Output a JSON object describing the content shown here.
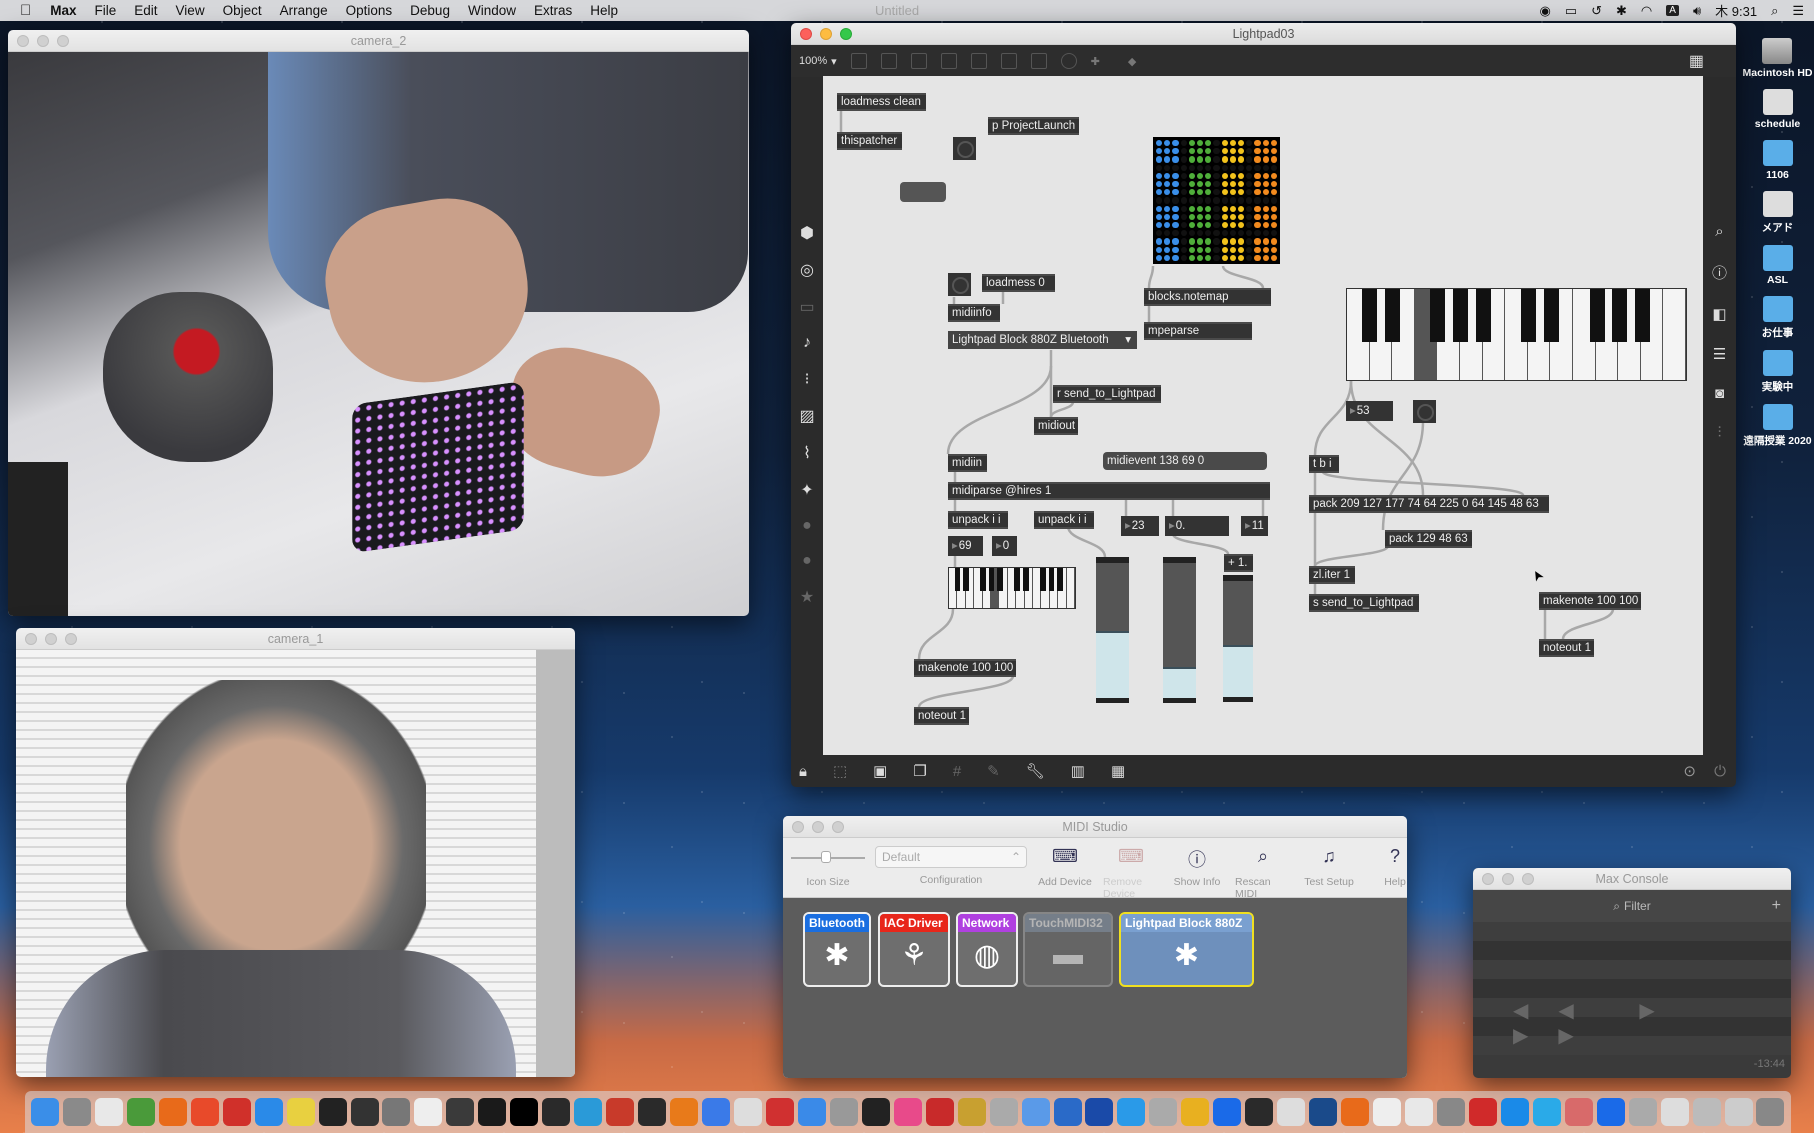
{
  "menubar": {
    "apple": "",
    "app": "Max",
    "items": [
      "File",
      "Edit",
      "View",
      "Object",
      "Arrange",
      "Options",
      "Debug",
      "Window",
      "Extras",
      "Help"
    ],
    "center_title": "Untitled",
    "clock": "木 9:31",
    "input_method": "A"
  },
  "camera2": {
    "title": "camera_2"
  },
  "camera1": {
    "title": "camera_1"
  },
  "patcher": {
    "title": "Lightpad03",
    "zoom": "100%",
    "objects": [
      {
        "id": "loadmess_clean",
        "text": "loadmess clean"
      },
      {
        "id": "thispatcher",
        "text": "thispatcher"
      },
      {
        "id": "projectlaunch",
        "text": "p ProjectLaunch"
      },
      {
        "id": "loadmess0",
        "text": "loadmess 0"
      },
      {
        "id": "midiinfo",
        "text": "midiinfo"
      },
      {
        "id": "blocks_notemap",
        "text": "blocks.notemap"
      },
      {
        "id": "mpeparse",
        "text": "mpeparse"
      },
      {
        "id": "r_send",
        "text": "r send_to_Lightpad"
      },
      {
        "id": "midiout",
        "text": "midiout"
      },
      {
        "id": "midiin",
        "text": "midiin"
      },
      {
        "id": "midiparse",
        "text": "midiparse @hires 1"
      },
      {
        "id": "unpack1",
        "text": "unpack i i"
      },
      {
        "id": "unpack2",
        "text": "unpack i i"
      },
      {
        "id": "plus1",
        "text": "+ 1."
      },
      {
        "id": "makenote_l",
        "text": "makenote 100 100"
      },
      {
        "id": "noteout_l",
        "text": "noteout 1"
      },
      {
        "id": "tbi",
        "text": "t b i"
      },
      {
        "id": "pack_big",
        "text": "pack 209 127 177 74 64 225 0 64 145 48 63"
      },
      {
        "id": "pack_small",
        "text": "pack 129 48 63"
      },
      {
        "id": "zliter",
        "text": "zl.iter 1"
      },
      {
        "id": "s_send",
        "text": "s send_to_Lightpad"
      },
      {
        "id": "makenote_r",
        "text": "makenote 100 100"
      },
      {
        "id": "noteout_r",
        "text": "noteout 1"
      }
    ],
    "messages": [
      {
        "id": "midievent",
        "text": "midievent 138 69 0"
      }
    ],
    "menu": {
      "selected": "Lightpad Block 880Z Bluetooth"
    },
    "numbers": [
      {
        "id": "n23",
        "value": "23"
      },
      {
        "id": "n0f",
        "value": "0."
      },
      {
        "id": "n11",
        "value": "11"
      },
      {
        "id": "n69",
        "value": "69"
      },
      {
        "id": "n0",
        "value": "0"
      },
      {
        "id": "n53",
        "value": "53"
      }
    ],
    "sliders": [
      {
        "id": "s1",
        "fraction": 0.5
      },
      {
        "id": "s2",
        "fraction": 0.23
      },
      {
        "id": "s3",
        "fraction": 0.45
      }
    ],
    "keyboard_large": {
      "selected_note": 53
    },
    "keyboard_small": {
      "selected_note": 69
    },
    "led_colors": [
      "#3a8ee8",
      "#4fae3a",
      "#f2c21c",
      "#f28a1e"
    ]
  },
  "midistudio": {
    "title": "MIDI Studio",
    "config_value": "Default",
    "labels": {
      "icon_size": "Icon Size",
      "configuration": "Configuration"
    },
    "toolbar": [
      {
        "label": "Add Device",
        "icon": "add-device-icon"
      },
      {
        "label": "Remove Device",
        "icon": "remove-device-icon"
      },
      {
        "label": "Show Info",
        "icon": "show-info-icon"
      },
      {
        "label": "Rescan MIDI",
        "icon": "rescan-icon"
      },
      {
        "label": "Test Setup",
        "icon": "test-setup-icon"
      },
      {
        "label": "Help",
        "icon": "help-icon"
      }
    ],
    "devices": [
      {
        "name": "Bluetooth",
        "color": "#1a6ee0"
      },
      {
        "name": "IAC Driver",
        "color": "#e8261a"
      },
      {
        "name": "Network",
        "color": "#b040e0"
      },
      {
        "name": "TouchMIDI32",
        "color": "#8a9aae"
      },
      {
        "name": "Lightpad Block 880Z",
        "color": "#7aa0d0"
      }
    ]
  },
  "console": {
    "title": "Max Console",
    "filter_placeholder": "Filter",
    "time": "-13:44"
  },
  "desktop_icons": [
    {
      "label": "Macintosh HD",
      "type": "drive"
    },
    {
      "label": "schedule",
      "type": "doc"
    },
    {
      "label": "1106",
      "type": "folder"
    },
    {
      "label": "メアド",
      "type": "doc"
    },
    {
      "label": "ASL",
      "type": "folder"
    },
    {
      "label": "お仕事",
      "type": "folder"
    },
    {
      "label": "実験中",
      "type": "folder"
    },
    {
      "label": "遠隔授業 2020",
      "type": "folder"
    }
  ]
}
